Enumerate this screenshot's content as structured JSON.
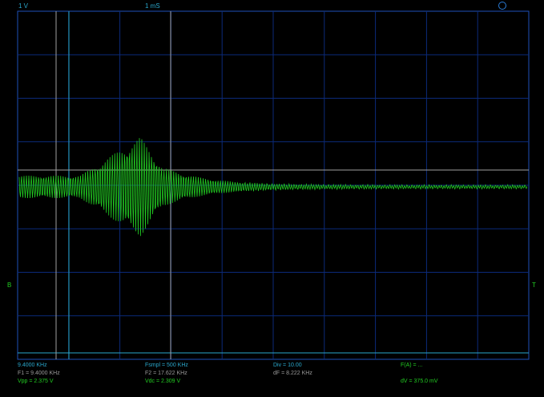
{
  "header": {
    "volts_div": "1 V",
    "time_div": "1 mS"
  },
  "markers": {
    "left": "B",
    "right": "T"
  },
  "readouts": {
    "freq": "9.4000 KHz",
    "f1": "F1 = 9.4000 KHz",
    "vpp": "Vpp = 2.375 V",
    "fsmpl": "Fsmpl = 500 KHz",
    "f2": "F2 = 17.622 KHz",
    "vdc": "Vdc = 2.309 V",
    "div": "Div = 10.00",
    "df": "dF = 8.222 KHz",
    "fa": "F(A) = ...",
    "dv": "dV = 375.0 mV"
  },
  "colors": {
    "background": "#000000",
    "grid": "#0b2a7a",
    "trace": "#22cc22",
    "cursor_line": "#a0a0a0",
    "cursor_cyan": "#2aa7cc"
  }
}
